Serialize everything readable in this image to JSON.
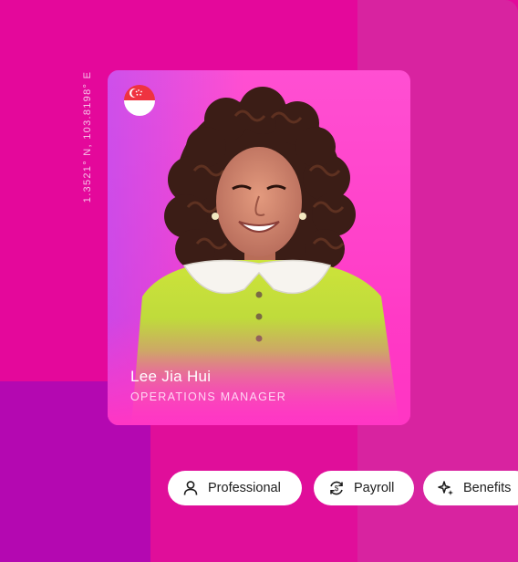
{
  "location": {
    "coordinates": "1.3521° N, 103.8198° E"
  },
  "profile_card": {
    "flag_icon": "singapore-flag-icon",
    "name": "Lee Jia Hui",
    "role": "OPERATIONS MANAGER"
  },
  "chips": [
    {
      "label": "Professional",
      "icon": "person-icon"
    },
    {
      "label": "Payroll",
      "icon": "payroll-cycle-icon"
    },
    {
      "label": "Benefits",
      "icon": "sparkle-icon"
    }
  ],
  "colors": {
    "background": "#e4089b",
    "background_right": "#d823a0",
    "purple_block": "#b408b1",
    "card": "#ff3ec8",
    "chip": "#ffffff"
  }
}
